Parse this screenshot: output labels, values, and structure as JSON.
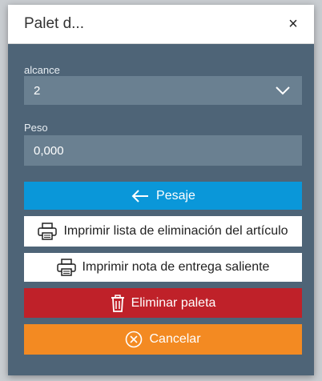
{
  "dialog": {
    "title": "Palet d...",
    "close_label": "×"
  },
  "scope": {
    "label": "alcance",
    "value": "2"
  },
  "weight": {
    "label": "Peso",
    "value": "0,000"
  },
  "buttons": {
    "weighing": "Pesaje",
    "print_removal_list": "Imprimir lista de eliminación del artículo",
    "print_delivery_note": "Imprimir nota de entrega saliente",
    "delete_pallet": "Eliminar paleta",
    "cancel": "Cancelar"
  },
  "colors": {
    "dialog_body": "#4e6477",
    "field_bg": "#6a8091",
    "primary": "#0a97d9",
    "danger": "#bf2129",
    "warning": "#f38a22"
  }
}
